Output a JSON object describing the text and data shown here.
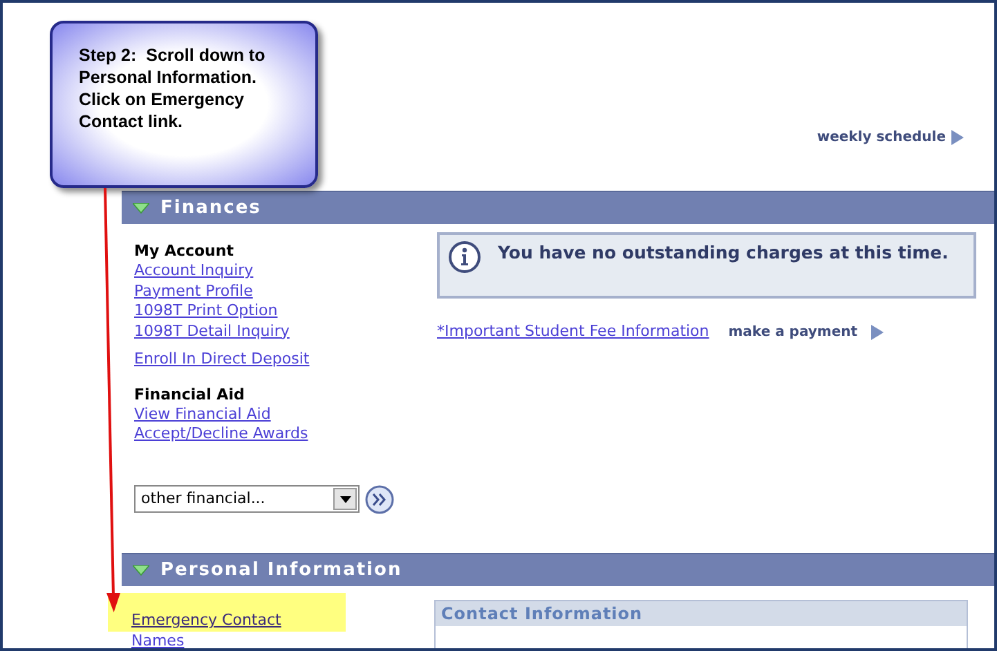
{
  "callout": {
    "text": "Step 2:  Scroll down to Personal Information.  Click on Emergency Contact link."
  },
  "weekly_schedule_link": "weekly schedule",
  "finances": {
    "title": "Finances",
    "expanded": true,
    "groups": [
      {
        "heading": "My Account",
        "links": [
          {
            "label": "Account Inquiry"
          },
          {
            "label": "Payment Profile"
          },
          {
            "label": "1098T Print Option"
          },
          {
            "label": "1098T Detail Inquiry"
          }
        ]
      },
      {
        "links": [
          {
            "label": "Enroll In Direct Deposit"
          }
        ]
      },
      {
        "heading": "Financial Aid",
        "links": [
          {
            "label": "View Financial Aid"
          },
          {
            "label": "Accept/Decline Awards"
          }
        ]
      }
    ],
    "dropdown": {
      "value": "other financial..."
    },
    "notice": "You have no outstanding charges at this time.",
    "fee_link": "*Important Student Fee Information",
    "payment_link": "make a payment"
  },
  "personal_information": {
    "title": "Personal Information",
    "expanded": true,
    "links": [
      {
        "label": "Emergency Contact",
        "highlighted": true
      },
      {
        "label": "Names",
        "highlighted": false
      }
    ],
    "contact_box_title": "Contact Information"
  }
}
